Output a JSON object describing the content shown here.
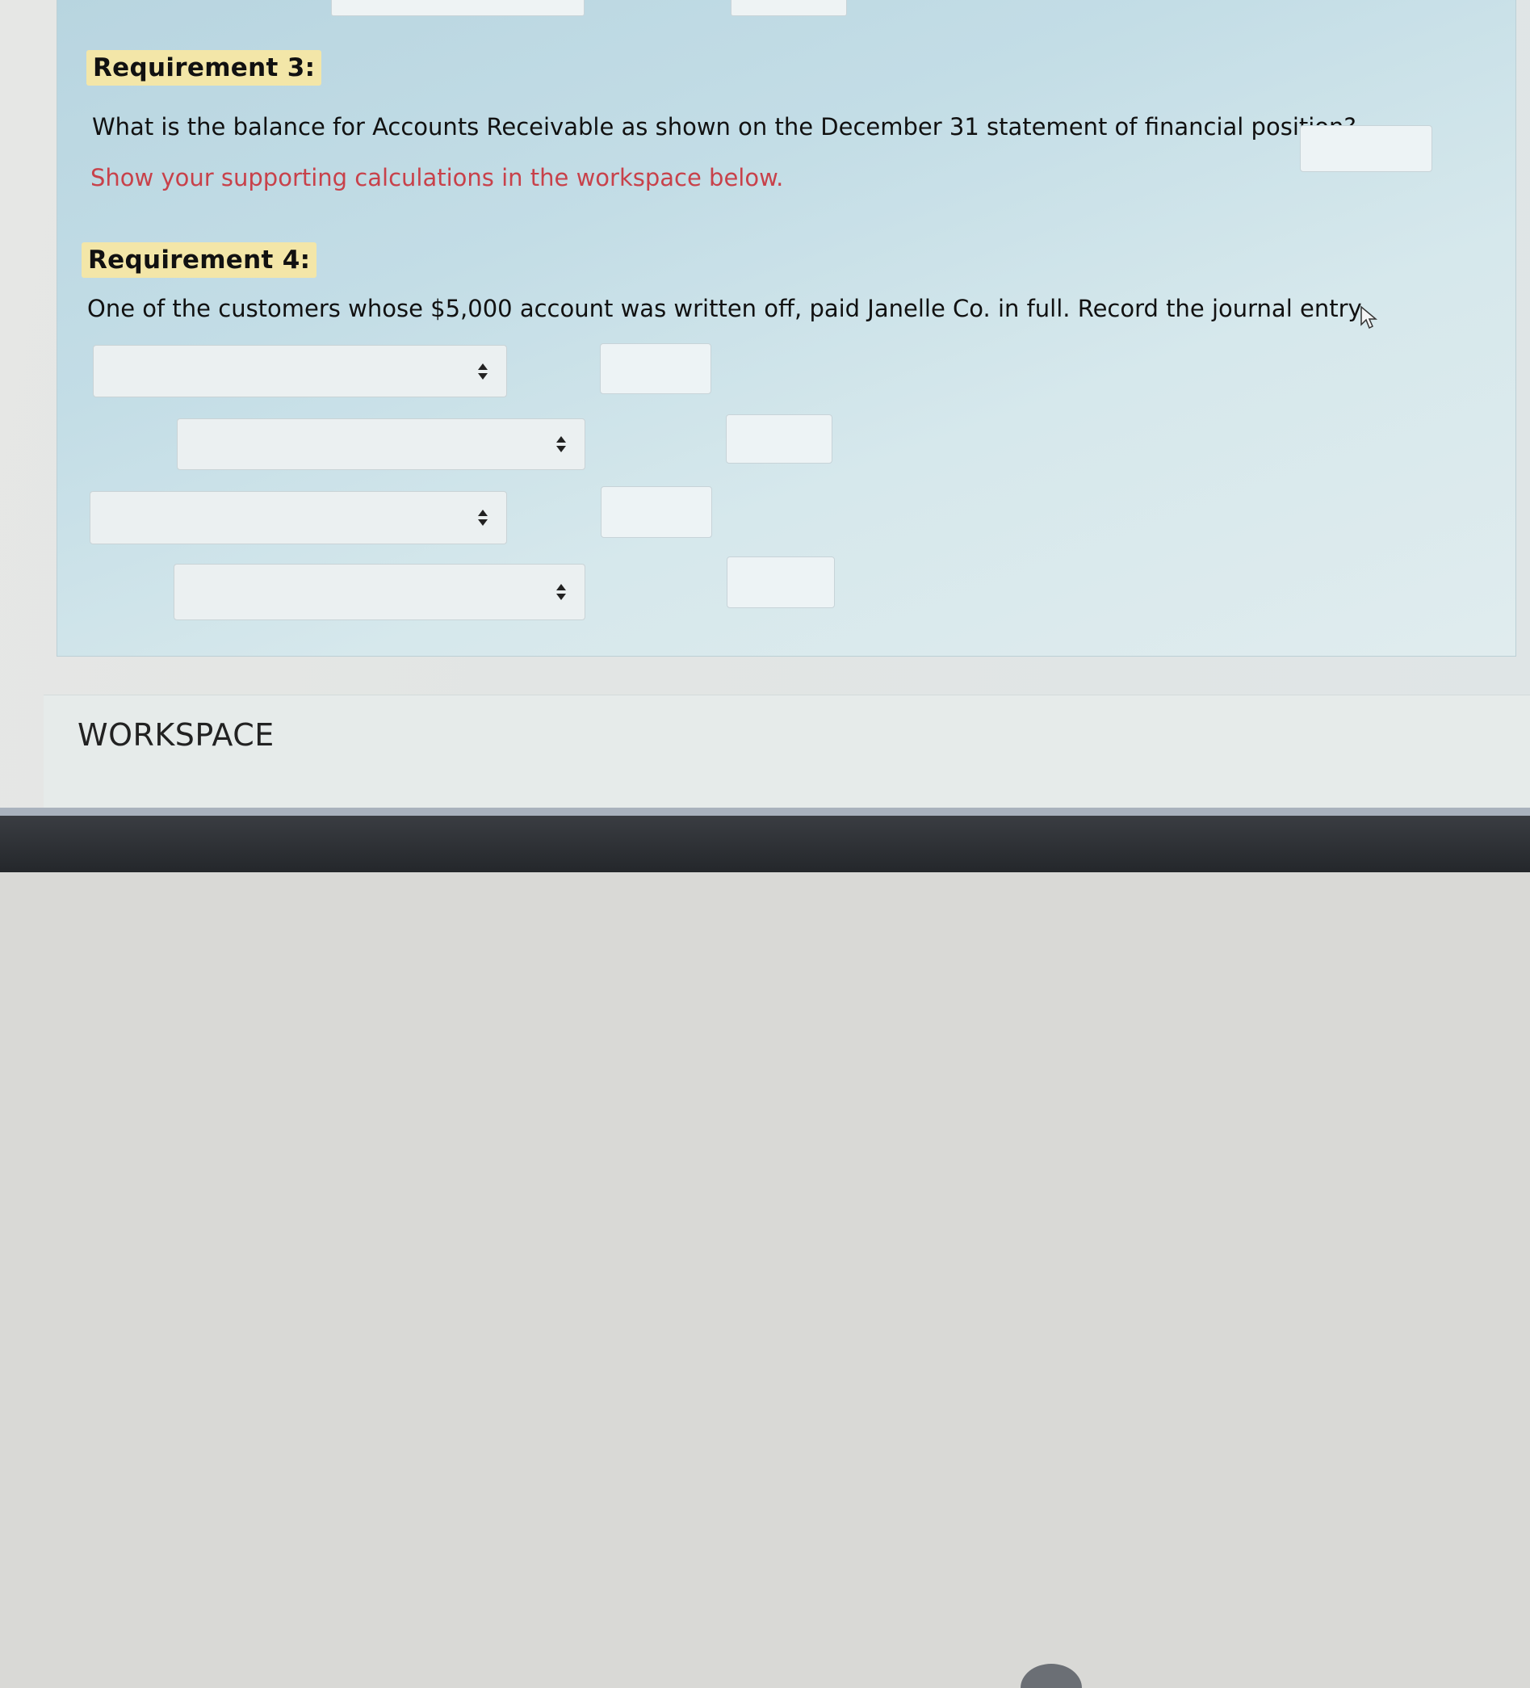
{
  "requirement3": {
    "heading": "Requirement 3:",
    "question": "What is the balance for Accounts Receivable as shown on the December 31 statement of financial position?",
    "answer_value": "",
    "hint": "Show your supporting calculations in the workspace below."
  },
  "requirement4": {
    "heading": "Requirement 4:",
    "question": "One of the customers whose $5,000 account was written off, paid Janelle Co. in full. Record the journal entry.",
    "journal_rows": [
      {
        "account": "",
        "amount": ""
      },
      {
        "account": "",
        "amount": ""
      },
      {
        "account": "",
        "amount": ""
      },
      {
        "account": "",
        "amount": ""
      }
    ]
  },
  "workspace": {
    "title": "WORKSPACE"
  },
  "icons": {
    "select_arrow": "up-down-chevron-icon",
    "cursor": "mouse-pointer-icon"
  },
  "colors": {
    "hint_text": "#c8414a",
    "heading_highlight": "#f3e6a8",
    "panel_bg": "#c3dde6"
  }
}
